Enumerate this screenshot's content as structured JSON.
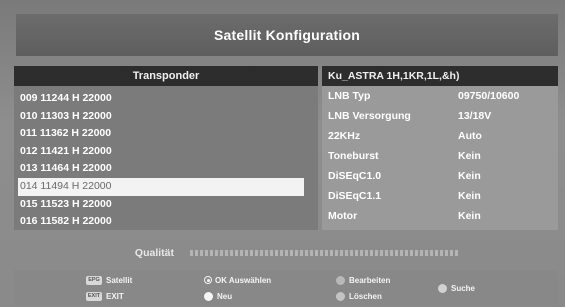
{
  "title": "Satellit Konfiguration",
  "transponder": {
    "header": "Transponder",
    "items": [
      "009 11244 H 22000",
      "010 11303 H 22000",
      "011 11362 H 22000",
      "012 11421 H 22000",
      "013 11464 H 22000",
      "014 11494 H 22000",
      "015 11523 H 22000",
      "016 11582 H 22000"
    ],
    "selected_index": 5
  },
  "config": {
    "satellite": "Ku_ASTRA 1H,1KR,1L,&h)",
    "rows": [
      {
        "label": "LNB Typ",
        "value": "09750/10600"
      },
      {
        "label": "LNB Versorgung",
        "value": "13/18V"
      },
      {
        "label": "22KHz",
        "value": "Auto"
      },
      {
        "label": "Toneburst",
        "value": "Kein"
      },
      {
        "label": "DiSEqC1.0",
        "value": "Kein"
      },
      {
        "label": "DiSEqC1.1",
        "value": "Kein"
      },
      {
        "label": "Motor",
        "value": "Kein"
      }
    ]
  },
  "quality": {
    "label": "Qualität",
    "level": 0
  },
  "footer": {
    "epg_key": "EPG",
    "satellit": "Satellit",
    "exit_key": "EXIT",
    "exit": "EXIT",
    "ok": "OK Auswählen",
    "neu": "Neu",
    "bearbeiten": "Bearbeiten",
    "loeschen": "Löschen",
    "suche": "Suche"
  },
  "colors": {
    "white_key": "#f5f5f5",
    "red_key": "#b8b8b8",
    "green_key": "#c4c4c4",
    "yellow_key": "#d2d2d2",
    "blue_key": "#c8c8c8"
  }
}
